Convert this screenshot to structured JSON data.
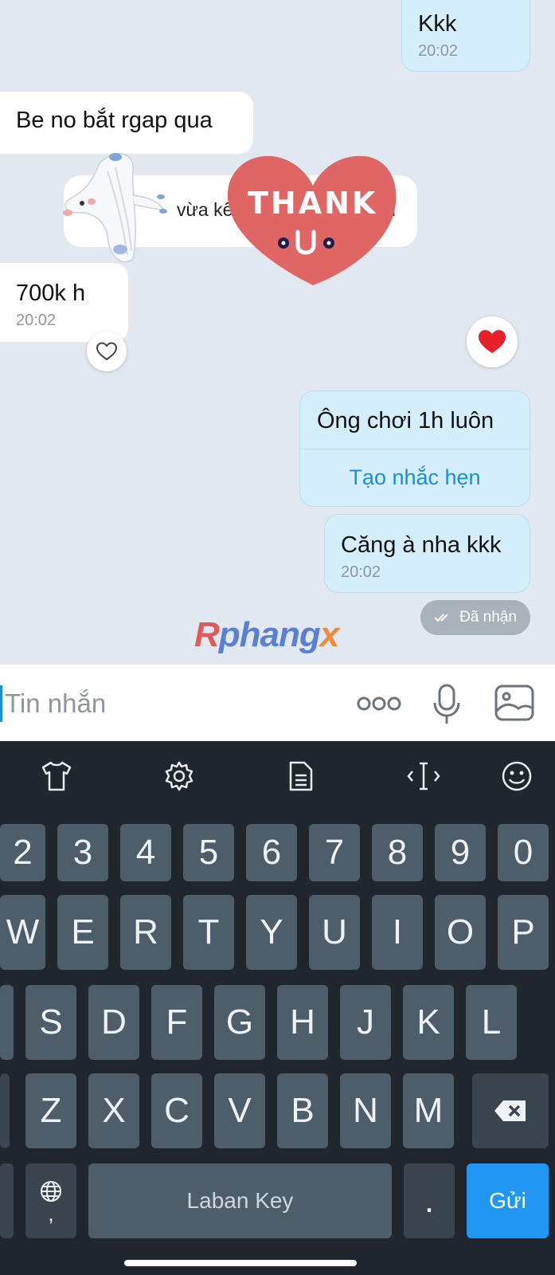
{
  "messages": {
    "kkk": {
      "text": "Kkk",
      "time": "20:02"
    },
    "be_no": {
      "text": "Be no bắt rgap qua"
    },
    "recall_text": {
      "left": "vừa kế",
      "right": "n"
    },
    "seven_hundred": {
      "text": "700k h",
      "time": "20:02"
    },
    "ong_choi": {
      "text": "Ông chơi 1h luôn",
      "reminder_label": "Tạo nhắc hẹn"
    },
    "cang_a": {
      "text": "Căng à nha kkk",
      "time": "20:02"
    }
  },
  "status": {
    "label": "Đã nhận"
  },
  "sticker": {
    "text": "THANK",
    "text2": "U"
  },
  "watermark": {
    "r": "R",
    "main": "phang",
    "x": "x"
  },
  "input": {
    "placeholder": "Tin nhắn"
  },
  "keyboard": {
    "number_row": [
      "2",
      "3",
      "4",
      "5",
      "6",
      "7",
      "8",
      "9",
      "0"
    ],
    "row1": [
      "W",
      "E",
      "R",
      "T",
      "Y",
      "U",
      "I",
      "O",
      "P"
    ],
    "row2": [
      "S",
      "D",
      "F",
      "G",
      "H",
      "J",
      "K",
      "L"
    ],
    "row3": [
      "Z",
      "X",
      "C",
      "V",
      "B",
      "N",
      "M"
    ],
    "comma": ",",
    "space_label": "Laban Key",
    "period": ".",
    "send_label": "Gửi"
  },
  "colors": {
    "accent": "#2196f3",
    "chat_bg": "#e2e8ef",
    "outgoing_bubble": "#d5eefc",
    "reaction_heart": "#e8202a"
  }
}
